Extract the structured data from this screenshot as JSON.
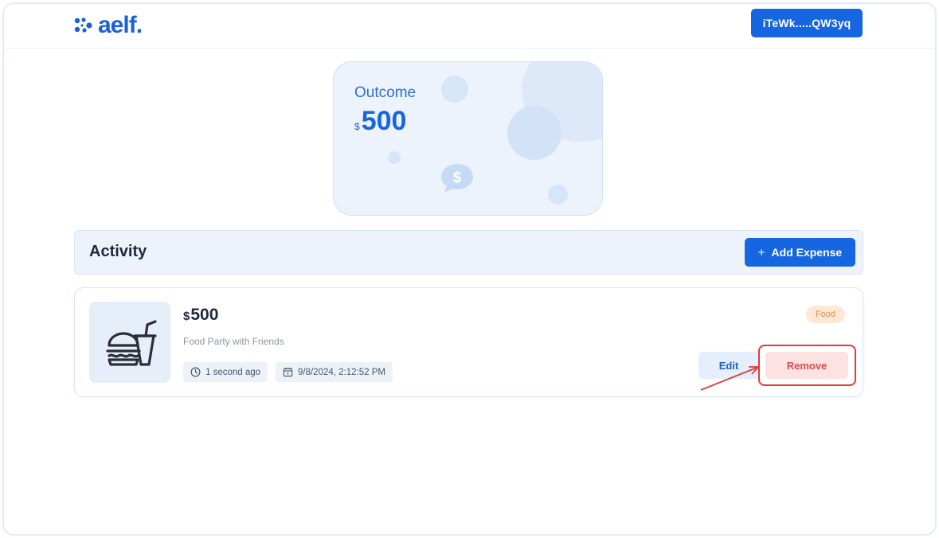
{
  "header": {
    "logo_text": "aelf.",
    "wallet_label": "iTeWk.....QW3yq"
  },
  "outcome": {
    "label": "Outcome",
    "currency": "$",
    "value": "500"
  },
  "activity": {
    "title": "Activity",
    "add_icon": "plus-icon",
    "add_label": "Add Expense"
  },
  "expense": {
    "icon": "fast-food-icon",
    "currency": "$",
    "amount": "500",
    "description": "Food Party with Friends",
    "time_ago": "1 second ago",
    "date": "9/8/2024, 2:12:52 PM",
    "category": "Food",
    "edit_label": "Edit",
    "remove_label": "Remove"
  },
  "colors": {
    "primary": "#1566e0",
    "highlight": "#e43a3a",
    "remove_bg": "#fde2e2",
    "tag_bg": "#fde8d6"
  }
}
